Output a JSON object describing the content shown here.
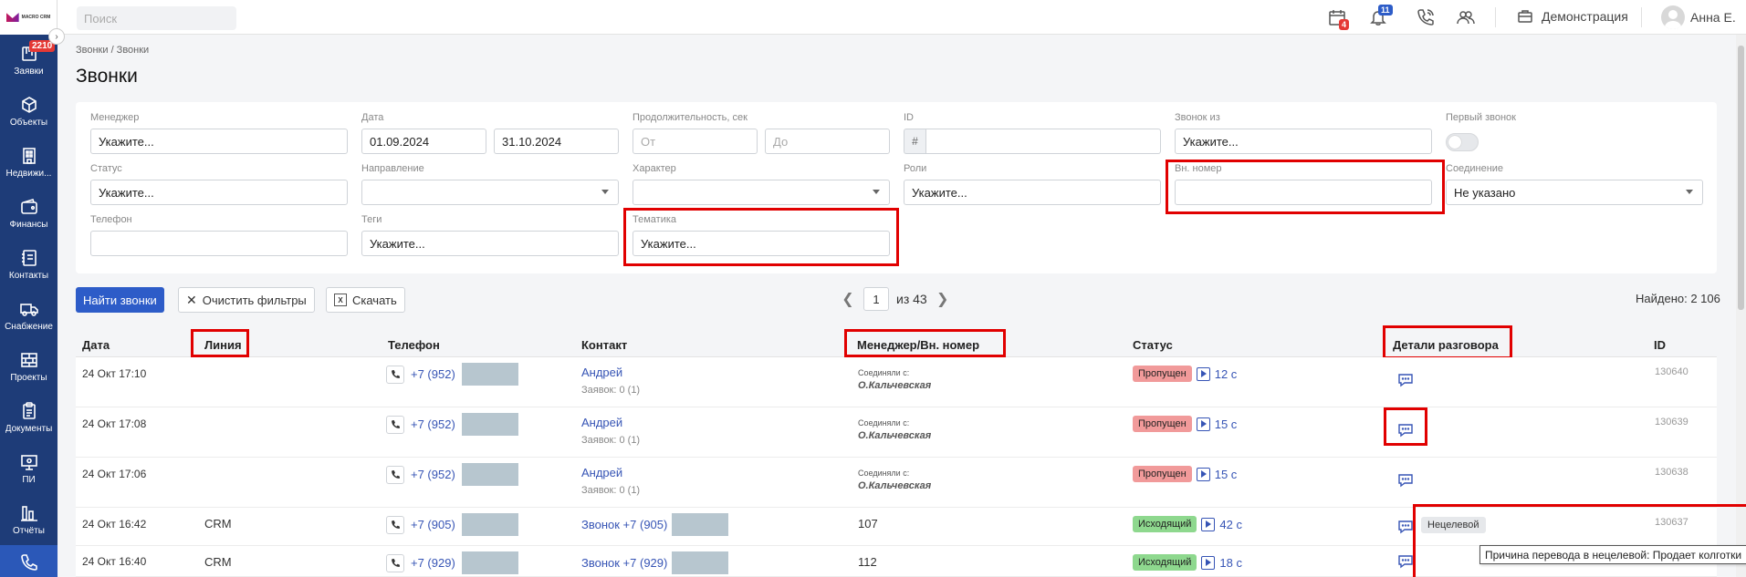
{
  "brand": {
    "logo_text": "MACRO CRM"
  },
  "sidebar": {
    "items": [
      {
        "label": "Заявки",
        "badge": "2210"
      },
      {
        "label": "Объекты"
      },
      {
        "label": "Недвижи..."
      },
      {
        "label": "Финансы"
      },
      {
        "label": "Контакты"
      },
      {
        "label": "Снабжение"
      },
      {
        "label": "Проекты"
      },
      {
        "label": "Документы"
      },
      {
        "label": "ПИ"
      },
      {
        "label": "Отчёты"
      }
    ]
  },
  "topbar": {
    "search_placeholder": "Поиск",
    "calendar_badge": "4",
    "notifications_badge": "11",
    "demo_label": "Демонстрация",
    "user_name": "Анна Е."
  },
  "breadcrumb": "Звонки / Звонки",
  "page_title": "Звонки",
  "filters": {
    "manager": {
      "label": "Менеджер",
      "value": "Укажите..."
    },
    "date": {
      "label": "Дата",
      "from": "01.09.2024",
      "to": "31.10.2024"
    },
    "duration": {
      "label": "Продолжительность, сек",
      "from_ph": "От",
      "to_ph": "До"
    },
    "id": {
      "label": "ID",
      "prefix": "#"
    },
    "call_from": {
      "label": "Звонок из",
      "value": "Укажите..."
    },
    "first_call": {
      "label": "Первый звонок"
    },
    "status": {
      "label": "Статус",
      "value": "Укажите..."
    },
    "direction": {
      "label": "Направление"
    },
    "character": {
      "label": "Характер"
    },
    "roles": {
      "label": "Роли",
      "value": "Укажите..."
    },
    "ext_number": {
      "label": "Вн. номер"
    },
    "connection": {
      "label": "Соединение",
      "value": "Не указано"
    },
    "phone": {
      "label": "Телефон"
    },
    "tags": {
      "label": "Теги",
      "value": "Укажите..."
    },
    "topic": {
      "label": "Тематика",
      "value": "Укажите..."
    }
  },
  "actions": {
    "find": "Найти звонки",
    "clear": "Очистить фильтры",
    "download": "Скачать",
    "xlsx_icon_text": "X"
  },
  "pagination": {
    "page": "1",
    "of_text": "из 43"
  },
  "found_text": "Найдено: 2 106",
  "table": {
    "headers": {
      "date": "Дата",
      "line": "Линия",
      "phone": "Телефон",
      "contact": "Контакт",
      "manager": "Менеджер/Вн. номер",
      "status": "Статус",
      "details": "Детали разговора",
      "id": "ID"
    },
    "rows": [
      {
        "date": "24 Окт 17:10",
        "line": "",
        "phone": "+7 (952)",
        "contact": "Андрей",
        "contact_sub": "Заявок: 0 (1)",
        "mgr_s1": "Соединяли с:",
        "mgr_s2": "О.Кальчевская",
        "status": "Пропущен",
        "duration": "12 с",
        "id": "130640"
      },
      {
        "date": "24 Окт 17:08",
        "line": "",
        "phone": "+7 (952)",
        "contact": "Андрей",
        "contact_sub": "Заявок: 0 (1)",
        "mgr_s1": "Соединяли с:",
        "mgr_s2": "О.Кальчевская",
        "status": "Пропущен",
        "duration": "15 с",
        "id": "130639"
      },
      {
        "date": "24 Окт 17:06",
        "line": "",
        "phone": "+7 (952)",
        "contact": "Андрей",
        "contact_sub": "Заявок: 0 (1)",
        "mgr_s1": "Соединяли с:",
        "mgr_s2": "О.Кальчевская",
        "status": "Пропущен",
        "duration": "15 с",
        "id": "130638"
      },
      {
        "date": "24 Окт 16:42",
        "line": "CRM",
        "phone": "+7 (905)",
        "contact": "Звонок +7 (905)",
        "mgr_num": "107",
        "status": "Исходящий",
        "duration": "42 с",
        "tag": "Нецелевой",
        "id": "130637"
      },
      {
        "date": "24 Окт 16:40",
        "line": "CRM",
        "phone": "+7 (929)",
        "contact": "Звонок +7 (929)",
        "mgr_num": "112",
        "status": "Исходящий",
        "duration": "18 с",
        "id": ""
      }
    ]
  },
  "tooltip": "Причина перевода в нецелевой: Продает колготки"
}
